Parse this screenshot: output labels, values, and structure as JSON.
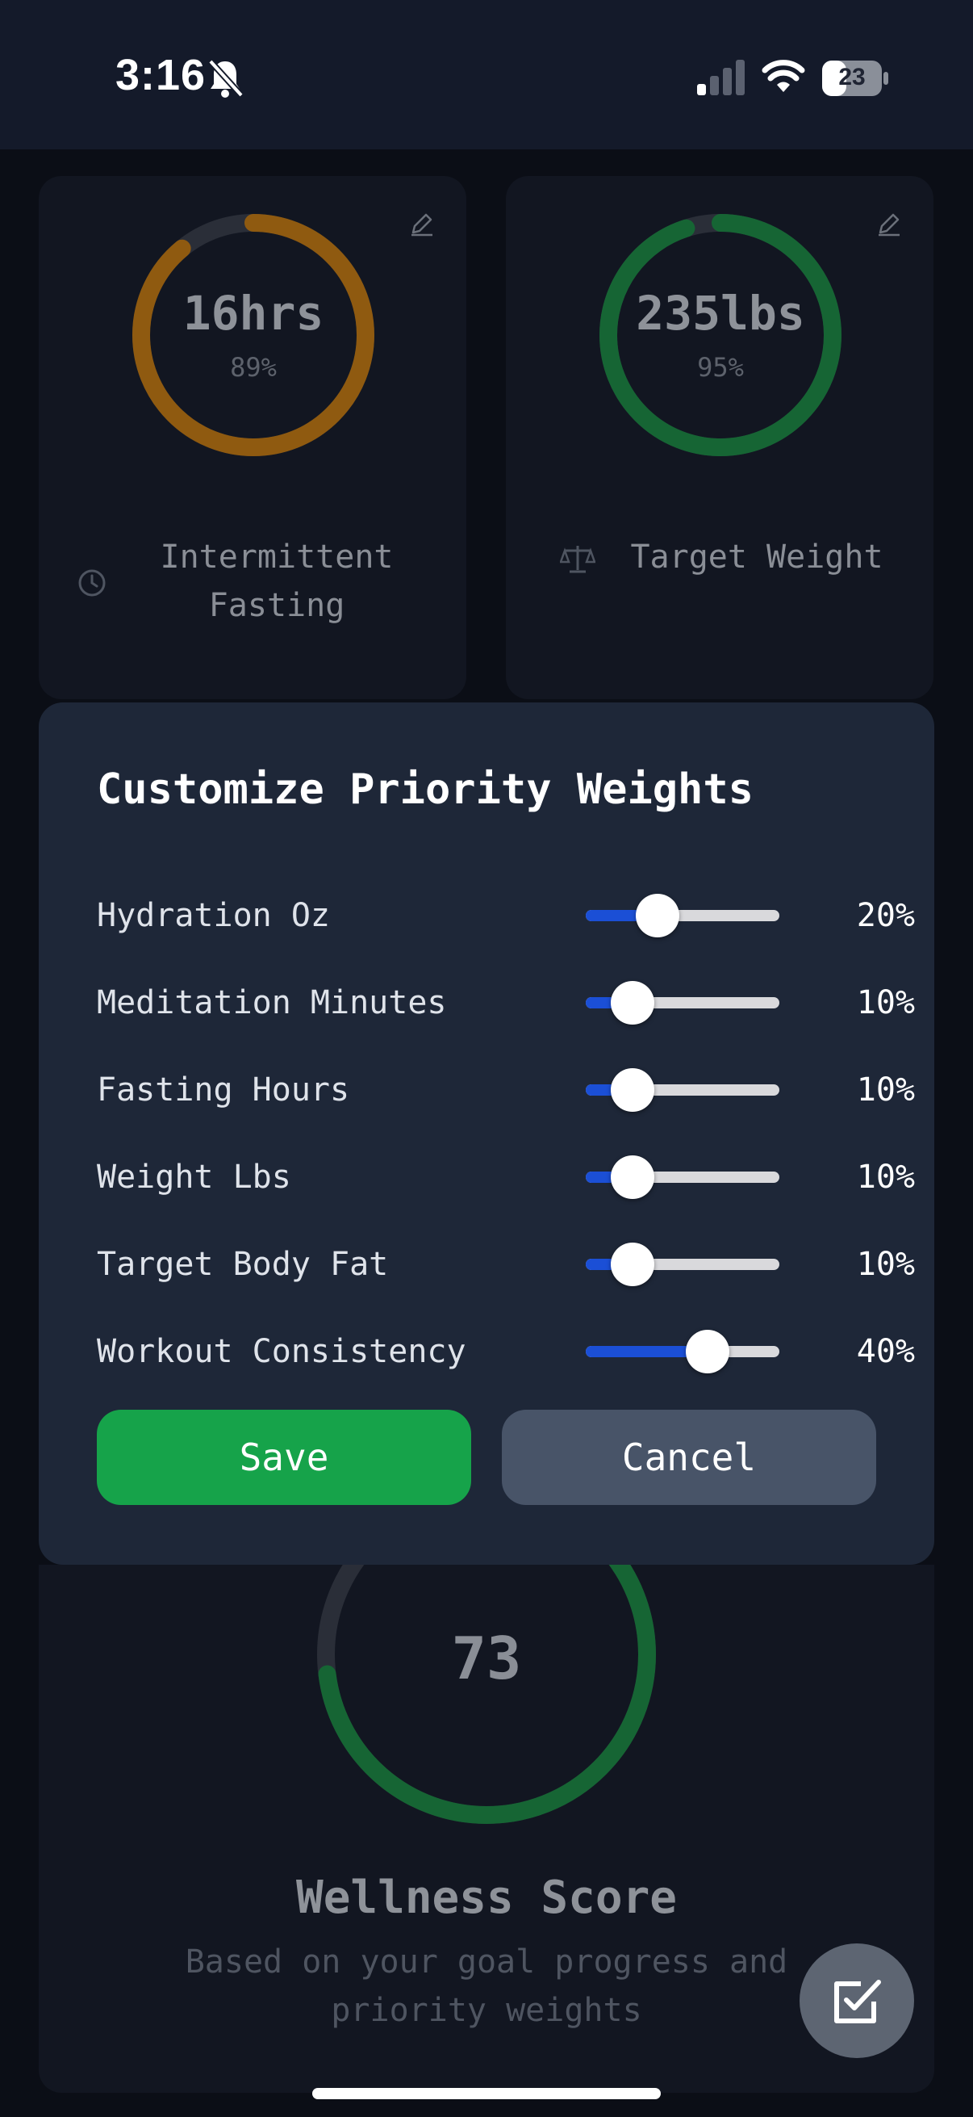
{
  "status_bar": {
    "time": "3:16",
    "battery": "23"
  },
  "cards": [
    {
      "value": "16hrs",
      "percent": "89%",
      "progress": 0.89,
      "ring_color": "#8f5a10",
      "icon": "clock-icon",
      "label_line1": "Intermittent",
      "label_line2": "Fasting"
    },
    {
      "value": "235lbs",
      "percent": "95%",
      "progress": 0.95,
      "ring_color": "#166534",
      "icon": "scale-icon",
      "label_line1": "Target Weight",
      "label_line2": ""
    }
  ],
  "modal": {
    "title": "Customize Priority Weights",
    "sliders": [
      {
        "label": "Hydration Oz",
        "value": 20,
        "display": "20%"
      },
      {
        "label": "Meditation Minutes",
        "value": 10,
        "display": "10%"
      },
      {
        "label": "Fasting Hours",
        "value": 10,
        "display": "10%"
      },
      {
        "label": "Weight Lbs",
        "value": 10,
        "display": "10%"
      },
      {
        "label": "Target Body Fat",
        "value": 10,
        "display": "10%"
      },
      {
        "label": "Workout Consistency",
        "value": 40,
        "display": "40%"
      }
    ],
    "save_label": "Save",
    "cancel_label": "Cancel"
  },
  "wellness": {
    "score": "73",
    "progress": 0.73,
    "title": "Wellness Score",
    "subtitle_line1": "Based on your goal progress and",
    "subtitle_line2": "priority weights"
  },
  "colors": {
    "accent_blue": "#1b4fd6",
    "save_green": "#16a34a",
    "ring_green": "#166534",
    "ring_orange": "#8f5a10"
  }
}
